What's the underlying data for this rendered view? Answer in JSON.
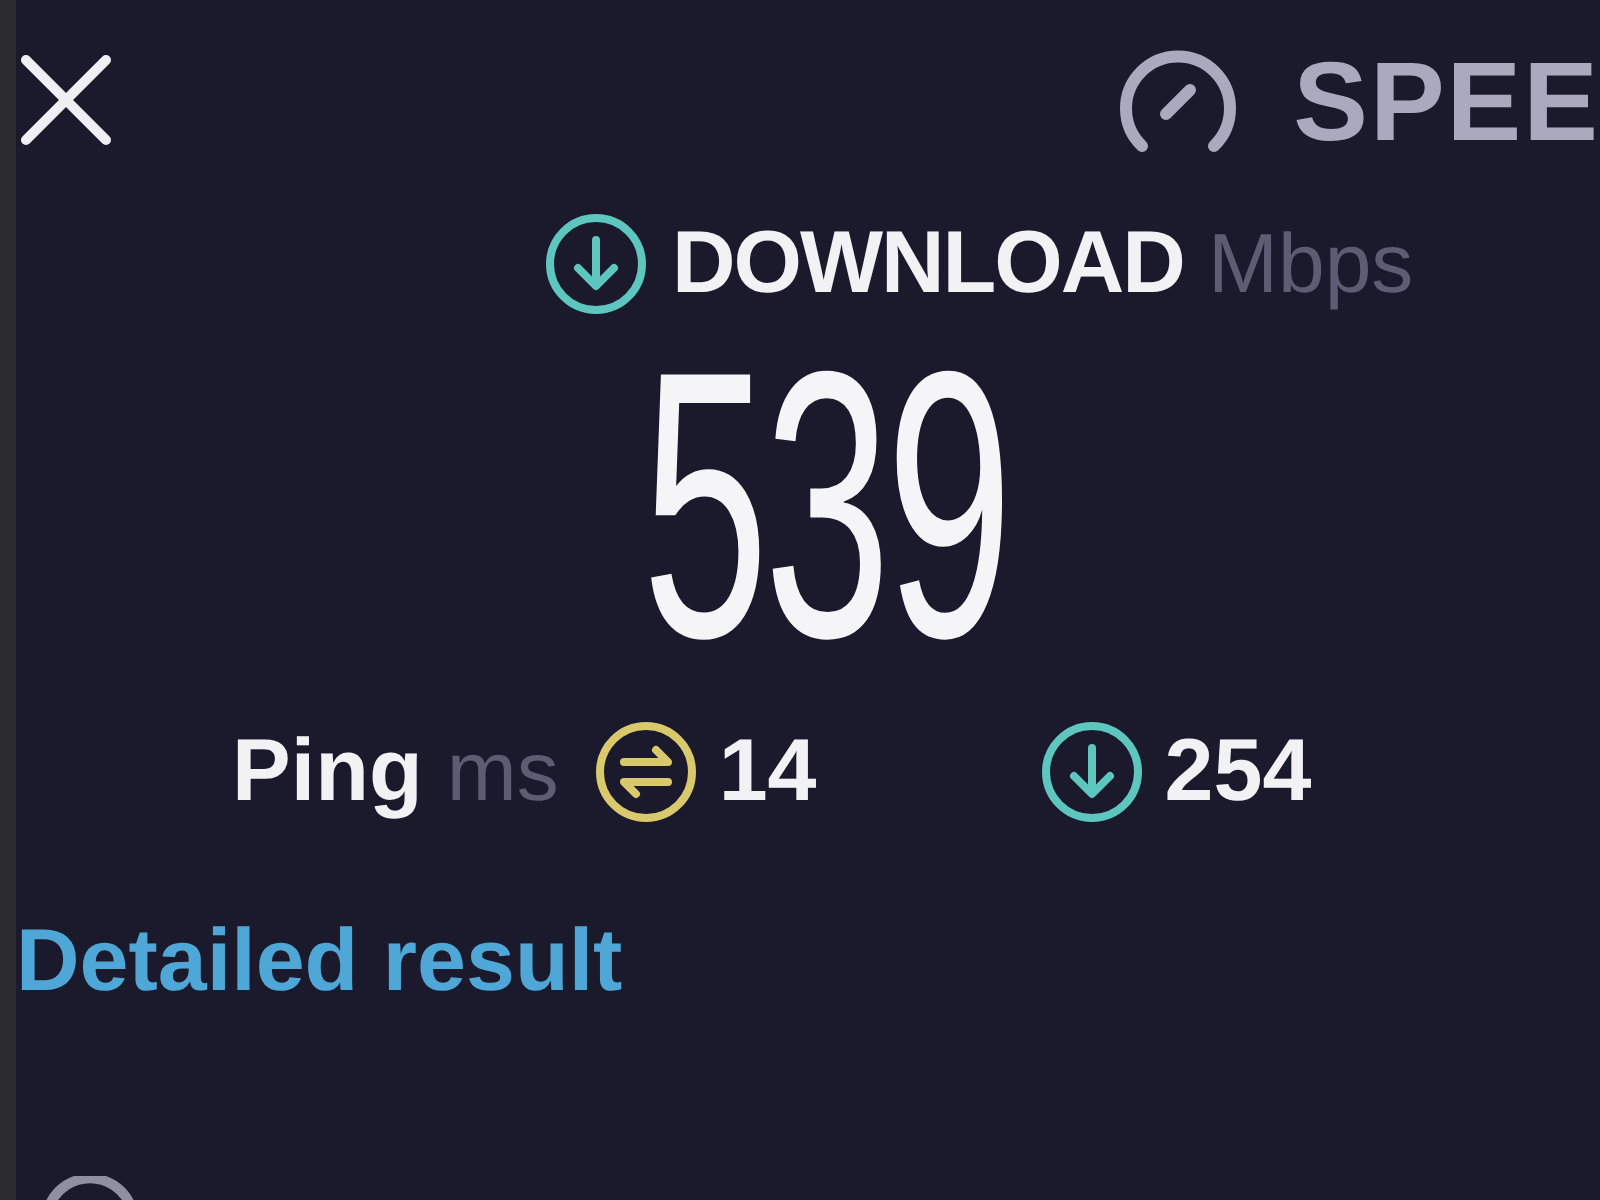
{
  "header": {
    "title": "SPEE"
  },
  "download": {
    "label": "DOWNLOAD",
    "unit": "Mbps",
    "value": "539"
  },
  "ping": {
    "label": "Ping",
    "unit": "ms"
  },
  "stats": [
    {
      "kind": "ping",
      "value": "14"
    },
    {
      "kind": "download",
      "value": "254"
    }
  ],
  "link": {
    "label": "Detailed result"
  }
}
